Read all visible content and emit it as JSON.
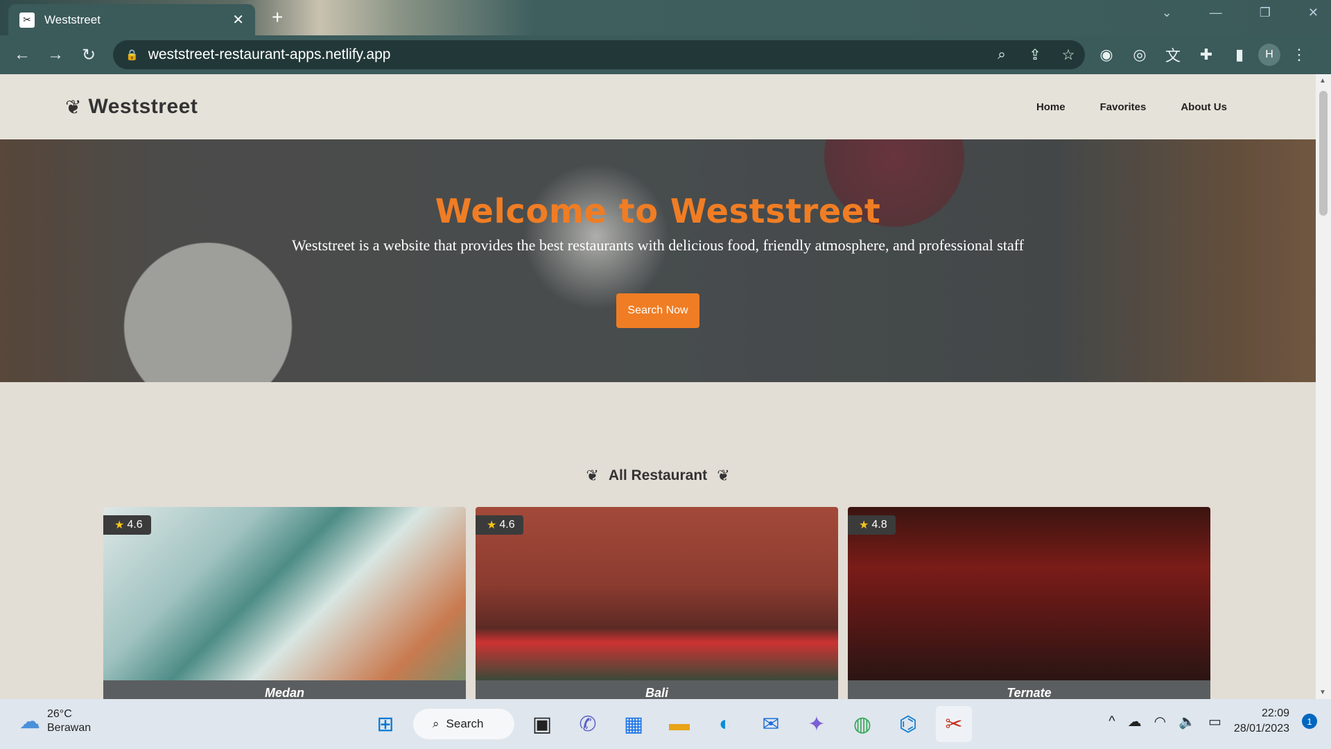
{
  "browser": {
    "tab_title": "Weststreet",
    "url": "weststreet-restaurant-apps.netlify.app",
    "profile_initial": "H"
  },
  "site": {
    "brand": "Weststreet",
    "nav": [
      "Home",
      "Favorites",
      "About Us"
    ],
    "hero": {
      "title": "Welcome to Weststreet",
      "subtitle": "Weststreet is a website that provides the best restaurants with delicious food, friendly atmosphere, and professional staff",
      "button": "Search Now"
    },
    "section_title": "All Restaurant",
    "restaurants": [
      {
        "city": "Medan",
        "rating": "4.6"
      },
      {
        "city": "Bali",
        "rating": "4.6"
      },
      {
        "city": "Ternate",
        "rating": "4.8"
      }
    ],
    "colors": {
      "accent": "#f07d24"
    }
  },
  "taskbar": {
    "weather_temp": "26°C",
    "weather_desc": "Berawan",
    "search_label": "Search",
    "time": "22:09",
    "date": "28/01/2023",
    "notification_count": "1"
  }
}
